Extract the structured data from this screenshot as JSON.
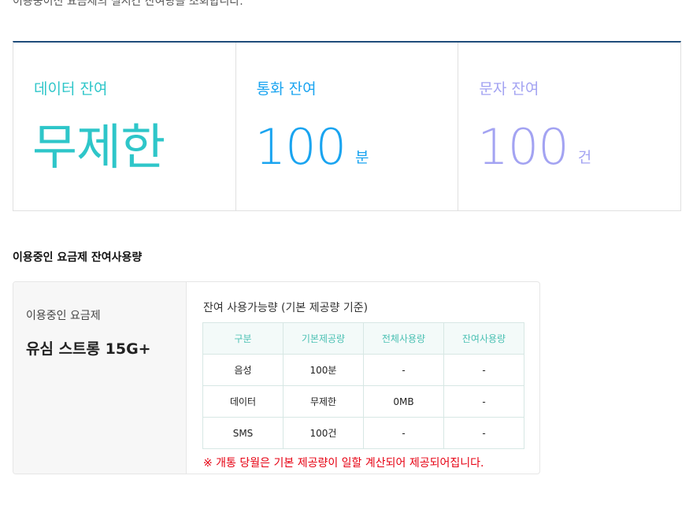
{
  "intro": "이용중이신 요금제의 실시간 잔여량을 조회합니다.",
  "summary": {
    "data": {
      "label": "데이터 잔여",
      "value": "무제한",
      "unit": ""
    },
    "voice": {
      "label": "통화 잔여",
      "value": "100",
      "unit": "분"
    },
    "sms": {
      "label": "문자 잔여",
      "value": "100",
      "unit": "건"
    }
  },
  "section_title": "이용중인 요금제 잔여사용량",
  "plan": {
    "label": "이용중인 요금제",
    "name": "유심 스트롱 15G+"
  },
  "usage": {
    "caption": "잔여 사용가능량 (기본 제공량 기준)",
    "headers": [
      "구분",
      "기본제공량",
      "전체사용량",
      "잔여사용량"
    ],
    "rows": [
      [
        "음성",
        "100분",
        "-",
        "-"
      ],
      [
        "데이터",
        "무제한",
        "0MB",
        "-"
      ],
      [
        "SMS",
        "100건",
        "-",
        "-"
      ]
    ],
    "notice": "※ 개통 당월은 기본 제공량이 일할 계산되어 제공되어집니다."
  },
  "colors": {
    "data": "#2ec6c9",
    "voice": "#1aa4f0",
    "sms": "#a3a3f2",
    "table_header": "#4cc1b4",
    "notice": "#e60012",
    "summary_top_border": "#1f4d7a"
  }
}
